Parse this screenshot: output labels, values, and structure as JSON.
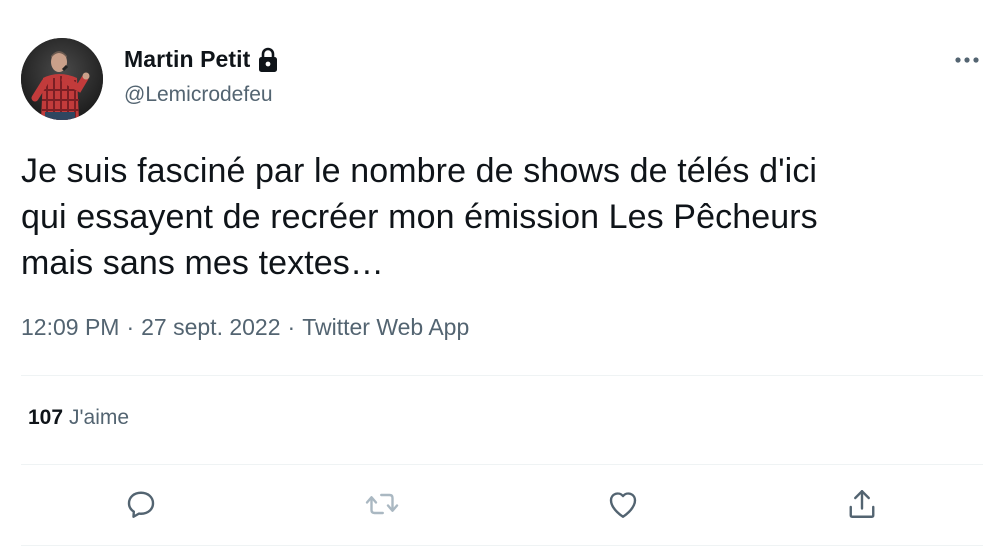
{
  "author": {
    "display_name": "Martin Petit",
    "handle": "@Lemicrodefeu",
    "avatar_icon": "avatar-photo",
    "protected_icon": "lock-icon"
  },
  "tweet": {
    "lines": [
      "Je suis fasciné par le nombre de shows de télés d'ici",
      "qui essayent de recréer mon émission Les Pêcheurs",
      "mais sans mes textes…"
    ]
  },
  "meta": {
    "time": "12:09 PM",
    "separator": "·",
    "date": "27 sept. 2022",
    "source": "Twitter Web App"
  },
  "stats": {
    "likes_count": "107",
    "likes_label": "J'aime"
  },
  "actions": {
    "reply_icon": "reply-icon",
    "retweet_icon": "retweet-icon",
    "like_icon": "heart-icon",
    "share_icon": "share-icon",
    "more_icon": "more-icon"
  },
  "colors": {
    "text_primary": "#0f1419",
    "text_secondary": "#536471",
    "divider": "#eff3f4",
    "icon_grey": "#536471"
  }
}
